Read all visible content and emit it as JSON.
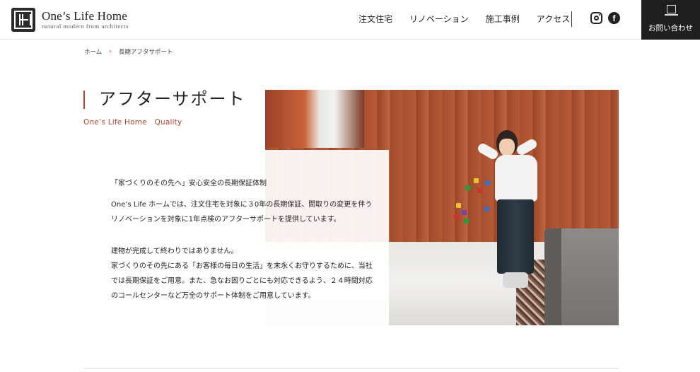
{
  "header": {
    "logo": {
      "name": "One’s Life Home",
      "tagline": "natural modern from architects"
    },
    "nav": [
      "注文住宅",
      "リノベーション",
      "施工事例",
      "アクセス"
    ],
    "contact_label": "お問い合わせ"
  },
  "breadcrumb": {
    "home": "ホーム",
    "separator": "›",
    "current": "長期アフタサポート"
  },
  "page": {
    "title": "アフターサポート",
    "subtitle": "One’s Life Home　Quality"
  },
  "body": {
    "lead": "「家づくりのその先へ」安心安全の長期保証体制",
    "para1": "One’s Life ホームでは、注文住宅を対象に３0年の長期保証、間取りの変更を伴うリノベーションを対象に1年点検のアフターサポートを提供しています。",
    "para2": "建物が完成して終わりではありません。\n家づくりのその先にある「お客様の毎日の生活」を末永くお守りするために、当社では長期保証をご用意。また、急なお困りごとにも対応できるよう、２４時間対応のコールセンターなど万全のサポート体制をご用意しています。"
  },
  "colors": {
    "accent": "#b5452e",
    "header_dark": "#1f1f1f"
  }
}
